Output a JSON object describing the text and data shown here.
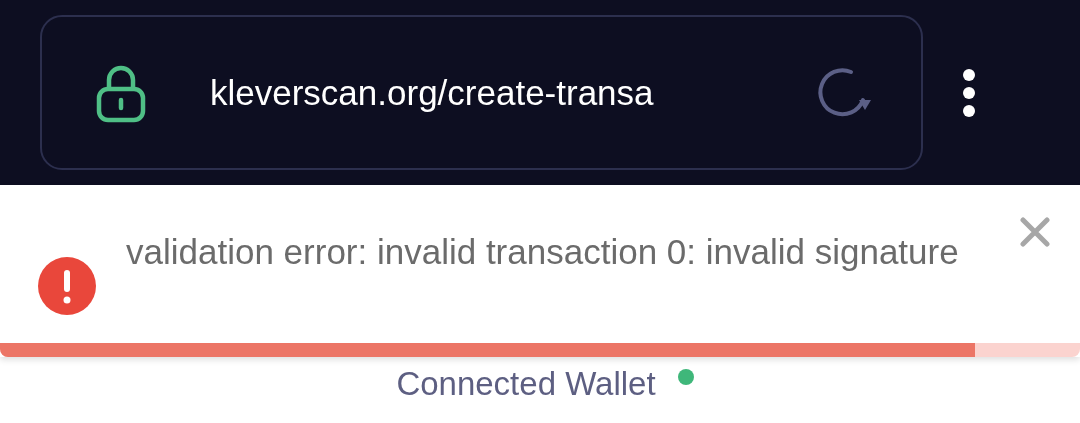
{
  "browser_bar": {
    "url": "kleverscan.org/create-transa",
    "secure": true
  },
  "toast": {
    "kind": "error",
    "message": "validation error: invalid transaction 0: invalid signature",
    "progress": {
      "level": 0.903
    }
  },
  "wallet_status": {
    "label": "Connected Wallet",
    "connected": true
  }
}
